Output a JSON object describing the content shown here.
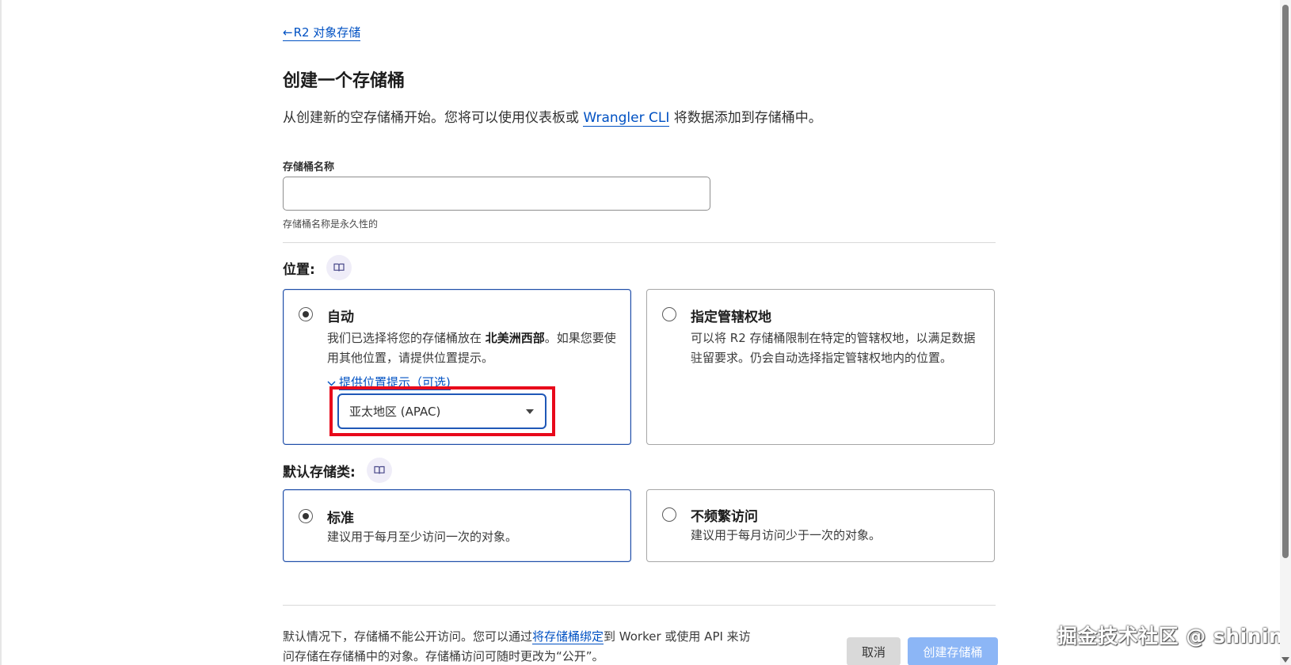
{
  "nav": {
    "back_arrow": "←",
    "back_label": "R2 对象存储"
  },
  "page_title": "创建一个存储桶",
  "intro": {
    "before": "从创建新的空存储桶开始。您将可以使用仪表板或 ",
    "link": "Wrangler CLI",
    "after": " 将数据添加到存储桶中。"
  },
  "bucket_name": {
    "label": "存储桶名称",
    "value": "",
    "placeholder": "",
    "help": "存储桶名称是永久性的"
  },
  "location": {
    "label": "位置:",
    "doc_icon": "book-icon",
    "options": [
      {
        "title": "自动",
        "selected": true,
        "desc_before": "我们已选择将您的存储桶放在 ",
        "desc_bold": "北美洲西部",
        "desc_after": "。如果您要使用其他位置，请提供位置提示。",
        "hint_toggle": "提供位置提示（可选)",
        "hint_value": "亚太地区 (APAC)"
      },
      {
        "title": "指定管辖权地",
        "selected": false,
        "desc": "可以将 R2 存储桶限制在特定的管辖权地，以满足数据驻留要求。仍会自动选择指定管辖权地内的位置。"
      }
    ]
  },
  "storage_class": {
    "label": "默认存储类:",
    "doc_icon": "book-icon",
    "options": [
      {
        "title": "标准",
        "selected": true,
        "desc": "建议用于每月至少访问一次的对象。"
      },
      {
        "title": "不频繁访问",
        "selected": false,
        "desc": "建议用于每月访问少于一次的对象。"
      }
    ]
  },
  "footer": {
    "note_before": "默认情况下，存储桶不能公开访问。您可以通过",
    "note_link": "将存储桶绑定",
    "note_after": "到 Worker 或使用 API 来访问存储在存储桶中的对象。存储桶访问可随时更改为“公开”。",
    "cancel_label": "取消",
    "create_label": "创建存储桶"
  },
  "watermark": "掘金技术社区 @ shining",
  "colors": {
    "link": "#0051c3",
    "highlight": "#e8091b",
    "primary_disabled": "#8cb6f6",
    "selected_border": "#1f4ea8"
  }
}
